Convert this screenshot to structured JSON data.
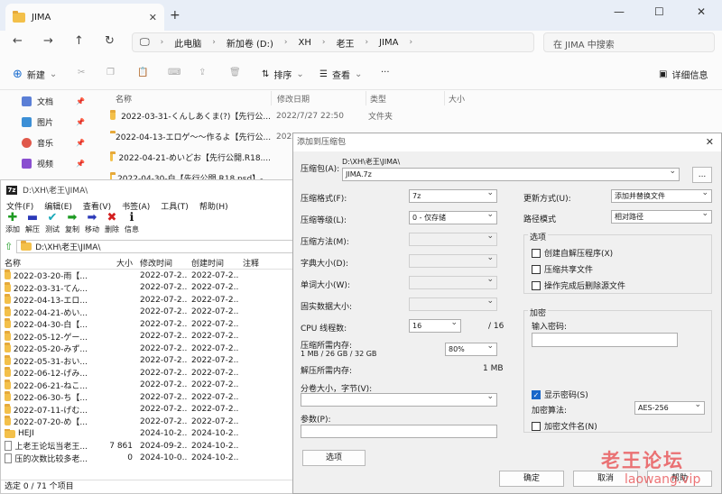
{
  "explorer": {
    "tab_title": "JIMA",
    "breadcrumb": [
      "此电脑",
      "新加卷 (D:)",
      "XH",
      "老王",
      "JIMA"
    ],
    "search_placeholder": "在 JIMA 中搜索",
    "toolbar": {
      "new": "新建",
      "sort": "排序",
      "view": "查看",
      "more": "···",
      "details": "详细信息"
    },
    "sidebar": [
      {
        "label": "文档",
        "icon": "document-icon",
        "color": "#5b7fd6"
      },
      {
        "label": "图片",
        "icon": "picture-icon",
        "color": "#3c8fd6"
      },
      {
        "label": "音乐",
        "icon": "music-icon",
        "color": "#e0584a"
      },
      {
        "label": "视频",
        "icon": "video-icon",
        "color": "#8a4fd0"
      }
    ],
    "columns": {
      "name": "名称",
      "date": "修改日期",
      "type": "类型",
      "size": "大小"
    },
    "rows": [
      {
        "name": "2022-03-31-くんしあくま(?)【先行公...",
        "date": "2022/7/27 22:50",
        "type": "文件夹"
      },
      {
        "name": "2022-04-13-エロゲ～～作るよ【先行公...",
        "date": "2022/7/27 22:45",
        "type": "文件夹"
      },
      {
        "name": "2022-04-21-めいどお【先行公開.R18....",
        "date": "",
        "type": ""
      },
      {
        "name": "2022-04-30-白【先行公開.R18.psd】-...",
        "date": "",
        "type": ""
      }
    ]
  },
  "sevenzip": {
    "title": "D:\\XH\\老王\\JIMA\\",
    "menu": [
      "文件(F)",
      "编辑(E)",
      "查看(V)",
      "书签(A)",
      "工具(T)",
      "帮助(H)"
    ],
    "tools": [
      {
        "label": "添加",
        "glyph": "✚",
        "color": "#1d9a22",
        "icon": "add-icon"
      },
      {
        "label": "解压",
        "glyph": "▬",
        "color": "#2b39b8",
        "icon": "extract-icon"
      },
      {
        "label": "测试",
        "glyph": "✔",
        "color": "#18a8b8",
        "icon": "test-icon"
      },
      {
        "label": "复制",
        "glyph": "➡",
        "color": "#1d9a22",
        "icon": "copy-icon"
      },
      {
        "label": "移动",
        "glyph": "➡",
        "color": "#2b39b8",
        "icon": "move-icon"
      },
      {
        "label": "删除",
        "glyph": "✖",
        "color": "#d31f1f",
        "icon": "delete-icon"
      },
      {
        "label": "信息",
        "glyph": "ℹ",
        "color": "#1b1b1b",
        "icon": "info-icon"
      }
    ],
    "path": "D:\\XH\\老王\\JIMA\\",
    "columns": {
      "name": "名称",
      "size": "大小",
      "modified": "修改时间",
      "created": "创建时间",
      "note": "注释"
    },
    "rows": [
      {
        "name": "2022-03-20-雨【...",
        "size": "",
        "modified": "2022-07-2...",
        "created": "2022-07-2...",
        "kind": "folder"
      },
      {
        "name": "2022-03-31-てん...",
        "size": "",
        "modified": "2022-07-2...",
        "created": "2022-07-2...",
        "kind": "folder"
      },
      {
        "name": "2022-04-13-エロ...",
        "size": "",
        "modified": "2022-07-2...",
        "created": "2022-07-2...",
        "kind": "folder"
      },
      {
        "name": "2022-04-21-めい...",
        "size": "",
        "modified": "2022-07-2...",
        "created": "2022-07-2...",
        "kind": "folder"
      },
      {
        "name": "2022-04-30-白【...",
        "size": "",
        "modified": "2022-07-2...",
        "created": "2022-07-2...",
        "kind": "folder"
      },
      {
        "name": "2022-05-12-ゲー...",
        "size": "",
        "modified": "2022-07-2...",
        "created": "2022-07-2...",
        "kind": "folder"
      },
      {
        "name": "2022-05-20-みず...",
        "size": "",
        "modified": "2022-07-2...",
        "created": "2022-07-2...",
        "kind": "folder"
      },
      {
        "name": "2022-05-31-おい...",
        "size": "",
        "modified": "2022-07-2...",
        "created": "2022-07-2...",
        "kind": "folder"
      },
      {
        "name": "2022-06-12-げみ...",
        "size": "",
        "modified": "2022-07-2...",
        "created": "2022-07-2...",
        "kind": "folder"
      },
      {
        "name": "2022-06-21-ねこ...",
        "size": "",
        "modified": "2022-07-2...",
        "created": "2022-07-2...",
        "kind": "folder"
      },
      {
        "name": "2022-06-30-ち【...",
        "size": "",
        "modified": "2022-07-2...",
        "created": "2022-07-2...",
        "kind": "folder"
      },
      {
        "name": "2022-07-11-げむ...",
        "size": "",
        "modified": "2022-07-2...",
        "created": "2022-07-2...",
        "kind": "folder"
      },
      {
        "name": "2022-07-20-め【...",
        "size": "",
        "modified": "2022-07-2...",
        "created": "2022-07-2...",
        "kind": "folder"
      },
      {
        "name": "HEJI",
        "size": "",
        "modified": "2024-10-2...",
        "created": "2024-10-2...",
        "kind": "folder"
      },
      {
        "name": "上老王论坛当老王...",
        "size": "7 861",
        "modified": "2024-09-2...",
        "created": "2024-10-2...",
        "kind": "file"
      },
      {
        "name": "压的次数比较多老...",
        "size": "0",
        "modified": "2024-10-0...",
        "created": "2024-10-2...",
        "kind": "file"
      }
    ],
    "status": "选定 0 / 71 个项目"
  },
  "dialog": {
    "title": "添加到压缩包",
    "archive_label": "压缩包(A):",
    "archive_dir": "D:\\XH\\老王\\JIMA\\",
    "archive_name": "JIMA.7z",
    "browse": "...",
    "format_label": "压缩格式(F):",
    "format_value": "7z",
    "level_label": "压缩等级(L):",
    "level_value": "0 - 仅存储",
    "method_label": "压缩方法(M):",
    "dict_label": "字典大小(D):",
    "word_label": "单词大小(W):",
    "solid_label": "固实数据大小:",
    "cpu_label": "CPU 线程数:",
    "cpu_value": "16",
    "cpu_total": "/ 16",
    "mem_label": "压缩所需内存:",
    "mem_detail": "1 MB / 26 GB / 32 GB",
    "mem_value": "80%",
    "dmem_label": "解压所需内存:",
    "dmem_value": "1 MB",
    "split_label": "分卷大小，字节(V):",
    "params_label": "参数(P):",
    "options_button": "选项",
    "update_label": "更新方式(U):",
    "update_value": "添加并替换文件",
    "pathmode_label": "路径模式",
    "pathmode_value": "相对路径",
    "options_group": "选项",
    "opt_sfx": "创建自解压程序(X)",
    "opt_shared": "压缩共享文件",
    "opt_delete": "操作完成后删除源文件",
    "enc_group": "加密",
    "pwd_label": "输入密码:",
    "show_pwd": "显示密码(S)",
    "enc_method_label": "加密算法:",
    "enc_method_value": "AES-256",
    "enc_names": "加密文件名(N)",
    "ok": "确定",
    "cancel": "取消",
    "help": "帮助"
  },
  "watermark": {
    "line1": "老王论坛",
    "line2": "laowang.vip"
  }
}
